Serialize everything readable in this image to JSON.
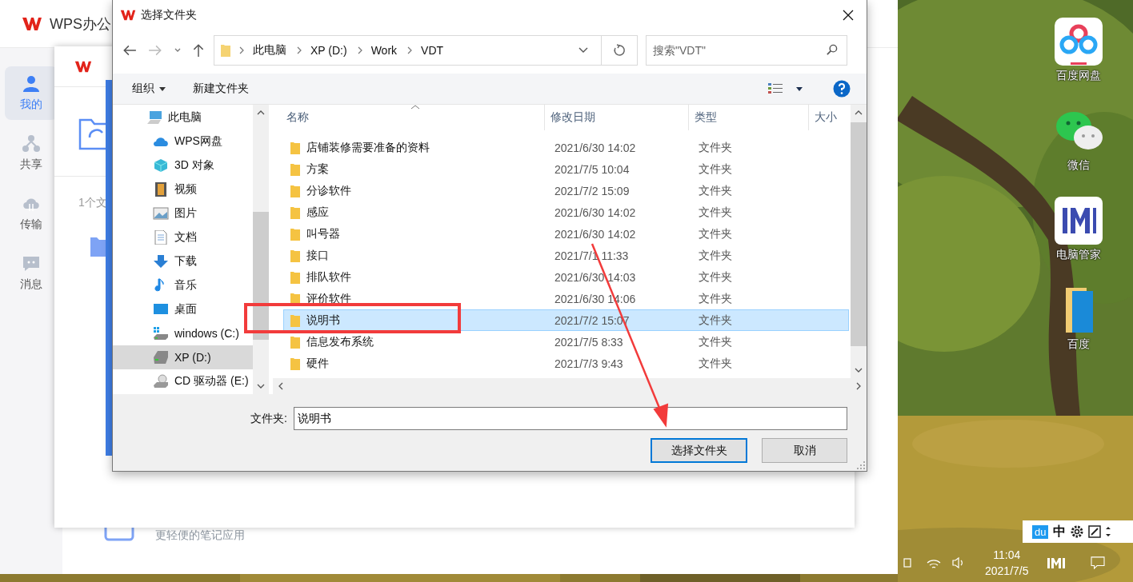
{
  "desktop": {
    "icons": [
      {
        "label": "百度网盘",
        "kind": "cloud"
      },
      {
        "label": "微信",
        "kind": "chat"
      },
      {
        "label": "电脑管家",
        "kind": "manager"
      },
      {
        "label": "百度",
        "kind": "folder"
      }
    ]
  },
  "wps_window": {
    "title": "WPS办公",
    "nav": [
      {
        "label": "我的",
        "kind": "user",
        "selected": true
      },
      {
        "label": "共享",
        "kind": "share",
        "selected": false
      },
      {
        "label": "传输",
        "kind": "transfer",
        "selected": false
      },
      {
        "label": "消息",
        "kind": "message",
        "selected": false
      }
    ],
    "footer_text": "更轻便的笔记应用"
  },
  "inner_window": {
    "count_text": "1个文"
  },
  "dialog": {
    "title": "选择文件夹",
    "breadcrumbs": [
      "此电脑",
      "XP (D:)",
      "Work",
      "VDT"
    ],
    "search": {
      "placeholder": "搜索\"VDT\""
    },
    "toolbar": {
      "organize": "组织",
      "new_folder": "新建文件夹"
    },
    "tree": [
      {
        "label": "此电脑",
        "kind": "pc",
        "selected": false,
        "children": [
          {
            "label": "WPS网盘",
            "kind": "cloud",
            "selected": false
          },
          {
            "label": "3D 对象",
            "kind": "cube",
            "selected": false
          },
          {
            "label": "视频",
            "kind": "video",
            "selected": false
          },
          {
            "label": "图片",
            "kind": "picture",
            "selected": false
          },
          {
            "label": "文档",
            "kind": "document",
            "selected": false
          },
          {
            "label": "下载",
            "kind": "download",
            "selected": false
          },
          {
            "label": "音乐",
            "kind": "music",
            "selected": false
          },
          {
            "label": "桌面",
            "kind": "desktop",
            "selected": false
          },
          {
            "label": "windows (C:)",
            "kind": "windrive",
            "selected": false
          },
          {
            "label": "XP (D:)",
            "kind": "drive",
            "selected": true
          },
          {
            "label": "CD 驱动器 (E:)",
            "kind": "cd",
            "selected": false
          }
        ]
      }
    ],
    "columns": [
      "名称",
      "修改日期",
      "类型",
      "大小"
    ],
    "rows": [
      {
        "name": "店铺装修需要准备的资料",
        "date": "2021/6/30 14:02",
        "type": "文件夹",
        "selected": false
      },
      {
        "name": "方案",
        "date": "2021/7/5 10:04",
        "type": "文件夹",
        "selected": false
      },
      {
        "name": "分诊软件",
        "date": "2021/7/2 15:09",
        "type": "文件夹",
        "selected": false
      },
      {
        "name": "感应",
        "date": "2021/6/30 14:02",
        "type": "文件夹",
        "selected": false
      },
      {
        "name": "叫号器",
        "date": "2021/6/30 14:02",
        "type": "文件夹",
        "selected": false
      },
      {
        "name": "接口",
        "date": "2021/7/1 11:33",
        "type": "文件夹",
        "selected": false
      },
      {
        "name": "排队软件",
        "date": "2021/6/30 14:03",
        "type": "文件夹",
        "selected": false
      },
      {
        "name": "评价软件",
        "date": "2021/6/30 14:06",
        "type": "文件夹",
        "selected": false
      },
      {
        "name": "说明书",
        "date": "2021/7/2 15:07",
        "type": "文件夹",
        "selected": true
      },
      {
        "name": "信息发布系统",
        "date": "2021/7/5 8:33",
        "type": "文件夹",
        "selected": false
      },
      {
        "name": "硬件",
        "date": "2021/7/3 9:43",
        "type": "文件夹",
        "selected": false
      }
    ],
    "folder_label": "文件夹:",
    "folder_value": "说明书",
    "buttons": [
      {
        "label": "选择文件夹",
        "default": true
      },
      {
        "label": "取消",
        "default": false
      }
    ]
  },
  "taskbar": {
    "ime": [
      "du",
      "中"
    ],
    "time": "11:04",
    "date": "2021/7/5"
  }
}
